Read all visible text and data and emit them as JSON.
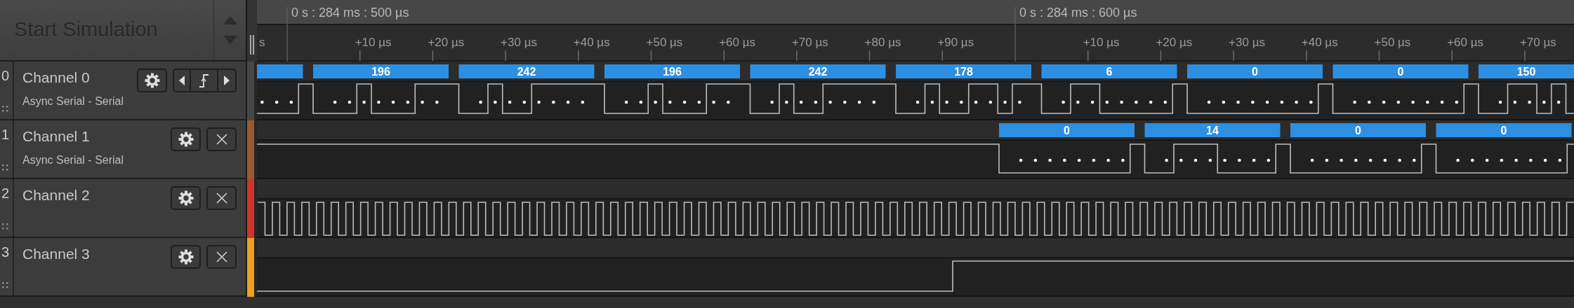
{
  "start_button": {
    "label": "Start Simulation",
    "disabled": true
  },
  "timeline": {
    "leading_label": "s",
    "groups": [
      {
        "time": "0 s : 284 ms : 500 µs",
        "ticks": [
          "+10 µs",
          "+20 µs",
          "+30 µs",
          "+40 µs",
          "+50 µs",
          "+60 µs",
          "+70 µs",
          "+80 µs",
          "+90 µs"
        ]
      },
      {
        "time": "0 s : 284 ms : 600 µs",
        "ticks": [
          "+10 µs",
          "+20 µs",
          "+30 µs",
          "+40 µs",
          "+50 µs",
          "+60 µs",
          "+70 µs"
        ]
      }
    ]
  },
  "channels": [
    {
      "index": "0",
      "name": "Channel 0",
      "analyzer": "Async Serial - Serial",
      "color": "#474747",
      "kind": "serial",
      "trigger_controls": true,
      "clipped_first_frame": true,
      "decodes": [
        {
          "label": "196"
        },
        {
          "label": "242"
        },
        {
          "label": "196"
        },
        {
          "label": "242"
        },
        {
          "label": "178"
        },
        {
          "label": "6"
        },
        {
          "label": "0"
        },
        {
          "label": "0"
        },
        {
          "label": "150"
        }
      ]
    },
    {
      "index": "1",
      "name": "Channel 1",
      "analyzer": "Async Serial - Serial",
      "color": "#9a5a2c",
      "kind": "serial",
      "trigger_controls": false,
      "decodes": [
        {
          "label": "0"
        },
        {
          "label": "14"
        },
        {
          "label": "0"
        },
        {
          "label": "0"
        }
      ]
    },
    {
      "index": "2",
      "name": "Channel 2",
      "color": "#d23428",
      "kind": "clock",
      "trigger_controls": false
    },
    {
      "index": "3",
      "name": "Channel 3",
      "color": "#f0a020",
      "kind": "step",
      "trigger_controls": false
    }
  ]
}
